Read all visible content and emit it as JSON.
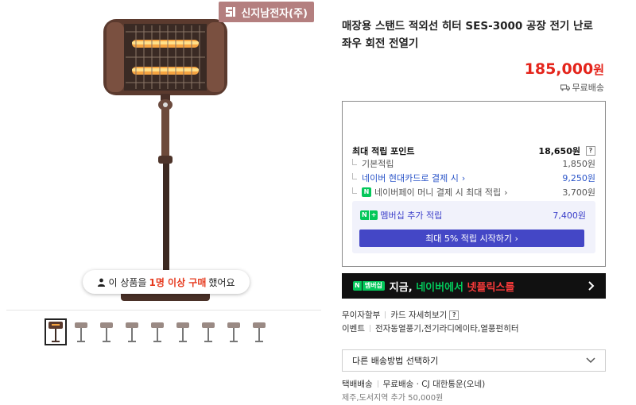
{
  "brand": {
    "name": "신지남전자(주)"
  },
  "gallery": {
    "buyer_notice": {
      "prefix": "이 상품을",
      "count": "1명 이상 구매",
      "suffix": "했어요"
    },
    "thumbnail_count": 9,
    "active_thumbnail": 0
  },
  "product": {
    "title": "매장용 스탠드 적외선 히터 SES-3000 공장 전기 난로 좌우 회전 전열기",
    "price": "185,000",
    "price_unit": "원",
    "shipping_label": "무료배송"
  },
  "points": {
    "max_label": "최대 적립 포인트",
    "max_value": "18,650원",
    "basic_label": "기본적립",
    "basic_value": "1,850원",
    "card_label": "네이버 현대카드로 결제 시",
    "card_value": "9,250원",
    "npay_label": "네이버페이 머니 결제 시 최대 적립",
    "npay_value": "3,700원",
    "member_label": "멤버십 추가 적립",
    "member_value": "7,400원",
    "member_button": "최대 5% 적립 시작하기"
  },
  "banner": {
    "badge": "멤버십",
    "text_white": "지금,",
    "text_green": "네이버에서",
    "text_red": "넷플릭스를"
  },
  "details": {
    "installment": "무이자할부",
    "card_benefit": "카드 자세히보기",
    "event_label": "이벤트",
    "event_value": "전자동열풍기,전기라디에이타,열풍펀히터",
    "delivery_select": "다른 배송방법 선택하기",
    "delivery_type": "택배배송",
    "delivery_fee": "무료배송",
    "delivery_company": "CJ 대한통운(오네)",
    "jeju_note": "제주,도서지역 추가 50,000원"
  }
}
